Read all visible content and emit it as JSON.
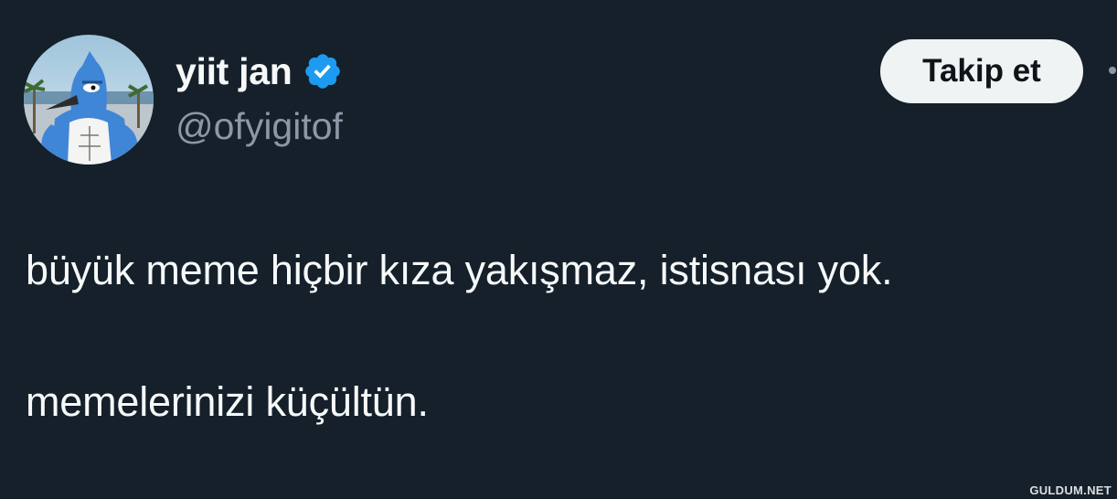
{
  "user": {
    "display_name": "yiit jan",
    "handle": "@ofyigitof",
    "verified": true
  },
  "actions": {
    "follow_label": "Takip et"
  },
  "tweet": {
    "lines": [
      "büyük meme hiçbir kıza yakışmaz, istisnası yok.",
      "memelerinizi küçültün."
    ]
  },
  "watermark": "GULDUM.NET",
  "colors": {
    "background": "#15202b",
    "text_primary": "#f7f9f9",
    "text_secondary": "#8b98a5",
    "verified_blue": "#1d9bf0",
    "follow_bg": "#eff3f4"
  }
}
